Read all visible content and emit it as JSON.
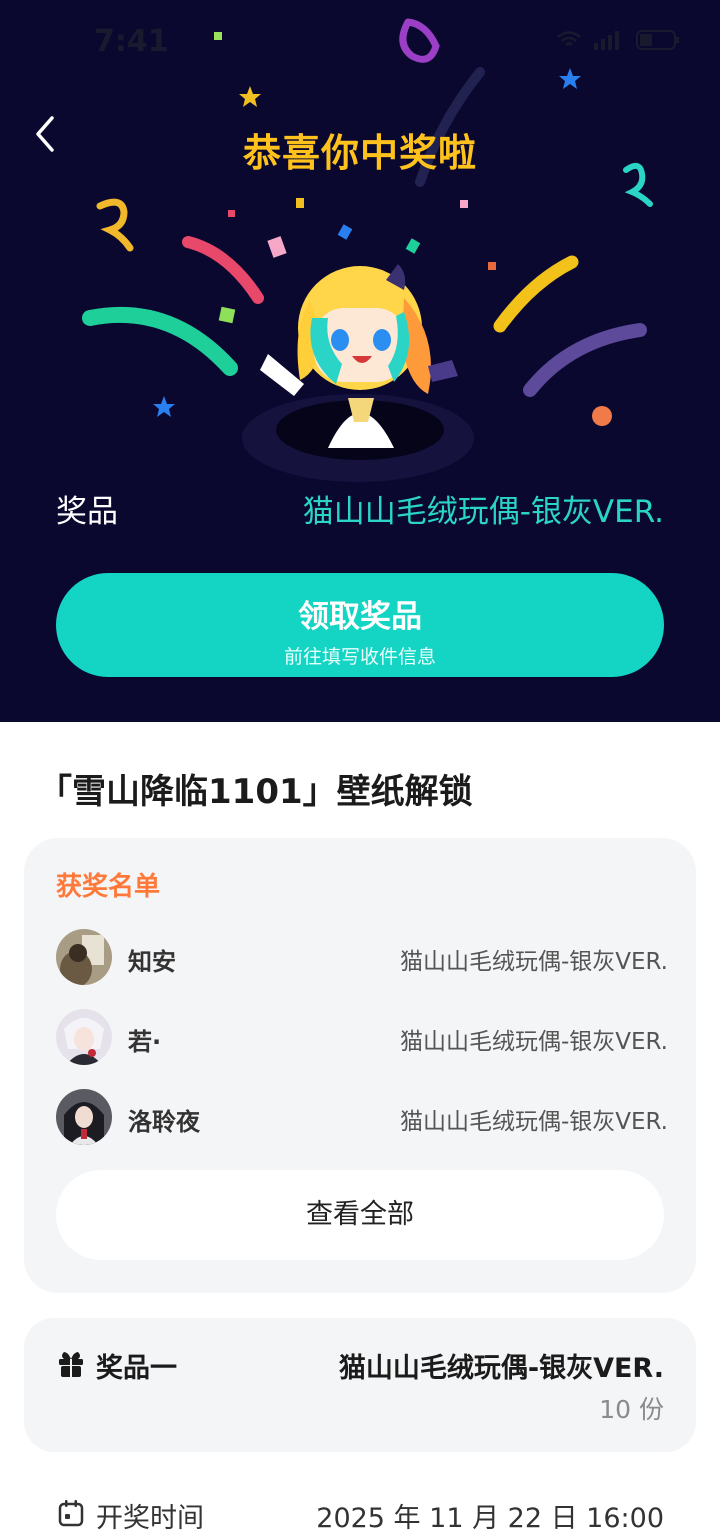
{
  "status_bar": {
    "time": "7:41"
  },
  "hero": {
    "title": "恭喜你中奖啦",
    "prize_label": "奖品",
    "prize_value": "猫山山毛绒玩偶-银灰VER.",
    "claim_button": {
      "title": "领取奖品",
      "subtitle": "前往填写收件信息"
    }
  },
  "event": {
    "title": "「雪山降临1101」壁纸解锁"
  },
  "winners": {
    "heading": "获奖名单",
    "list": [
      {
        "name": "知安",
        "prize": "猫山山毛绒玩偶-银灰VER."
      },
      {
        "name": "若·",
        "prize": "猫山山毛绒玩偶-银灰VER."
      },
      {
        "name": "洛聆夜",
        "prize": "猫山山毛绒玩偶-银灰VER."
      }
    ],
    "view_all": "查看全部"
  },
  "prize_info": {
    "tier": "奖品一",
    "name": "猫山山毛绒玩偶-银灰VER.",
    "quantity": "10 份"
  },
  "draw": {
    "label": "开奖时间",
    "time": "2025 年 11 月 22 日 16:00"
  },
  "colors": {
    "hero_bg": "#0b0830",
    "title_yellow": "#ffc21c",
    "accent_teal": "#14d4c4",
    "heading_orange": "#ff7a3a"
  }
}
